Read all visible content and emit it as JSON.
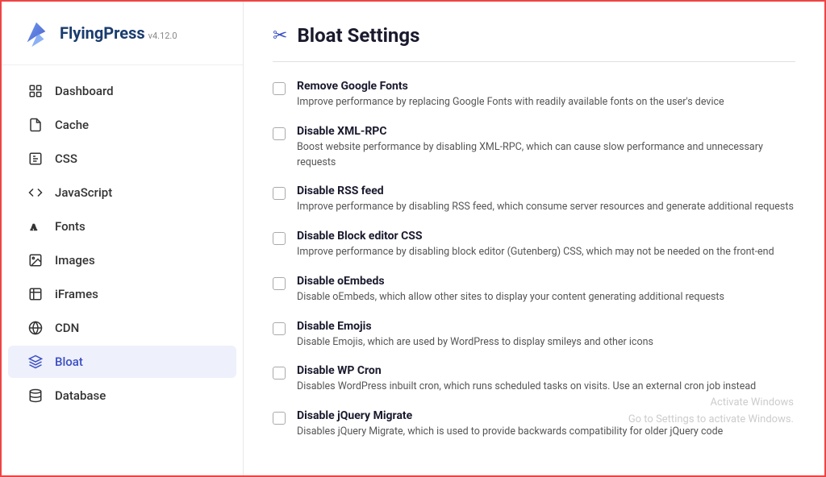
{
  "sidebar": {
    "logo": {
      "text": "FlyingPress",
      "version": "v4.12.0"
    },
    "items": [
      {
        "id": "dashboard",
        "label": "Dashboard",
        "icon": "dashboard"
      },
      {
        "id": "cache",
        "label": "Cache",
        "icon": "cache"
      },
      {
        "id": "css",
        "label": "CSS",
        "icon": "css"
      },
      {
        "id": "javascript",
        "label": "JavaScript",
        "icon": "javascript"
      },
      {
        "id": "fonts",
        "label": "Fonts",
        "icon": "fonts"
      },
      {
        "id": "images",
        "label": "Images",
        "icon": "images"
      },
      {
        "id": "iframes",
        "label": "iFrames",
        "icon": "iframes"
      },
      {
        "id": "cdn",
        "label": "CDN",
        "icon": "cdn"
      },
      {
        "id": "bloat",
        "label": "Bloat",
        "icon": "bloat",
        "active": true
      },
      {
        "id": "database",
        "label": "Database",
        "icon": "database"
      }
    ]
  },
  "main": {
    "page_title": "Bloat Settings",
    "settings": [
      {
        "id": "remove-google-fonts",
        "title": "Remove Google Fonts",
        "description": "Improve performance by replacing Google Fonts with readily available fonts on the user's device",
        "checked": false
      },
      {
        "id": "disable-xml-rpc",
        "title": "Disable XML-RPC",
        "description": "Boost website performance by disabling XML-RPC, which can cause slow performance and unnecessary requests",
        "checked": false
      },
      {
        "id": "disable-rss-feed",
        "title": "Disable RSS feed",
        "description": "Improve performance by disabling RSS feed, which consume server resources and generate additional requests",
        "checked": false
      },
      {
        "id": "disable-block-editor-css",
        "title": "Disable Block editor CSS",
        "description": "Improve performance by disabling block editor (Gutenberg) CSS, which may not be needed on the front-end",
        "checked": false
      },
      {
        "id": "disable-oembeds",
        "title": "Disable oEmbeds",
        "description": "Disable oEmbeds, which allow other sites to display your content generating additional requests",
        "checked": false
      },
      {
        "id": "disable-emojis",
        "title": "Disable Emojis",
        "description": "Disable Emojis, which are used by WordPress to display smileys and other icons",
        "checked": false
      },
      {
        "id": "disable-wp-cron",
        "title": "Disable WP Cron",
        "description": "Disables WordPress inbuilt cron, which runs scheduled tasks on visits. Use an external cron job instead",
        "checked": false
      },
      {
        "id": "disable-jquery-migrate",
        "title": "Disable jQuery Migrate",
        "description": "Disables jQuery Migrate, which is used to provide backwards compatibility for older jQuery code",
        "checked": false
      }
    ]
  },
  "watermark": {
    "line1": "Activate Windows",
    "line2": "Go to Settings to activate Windows."
  }
}
